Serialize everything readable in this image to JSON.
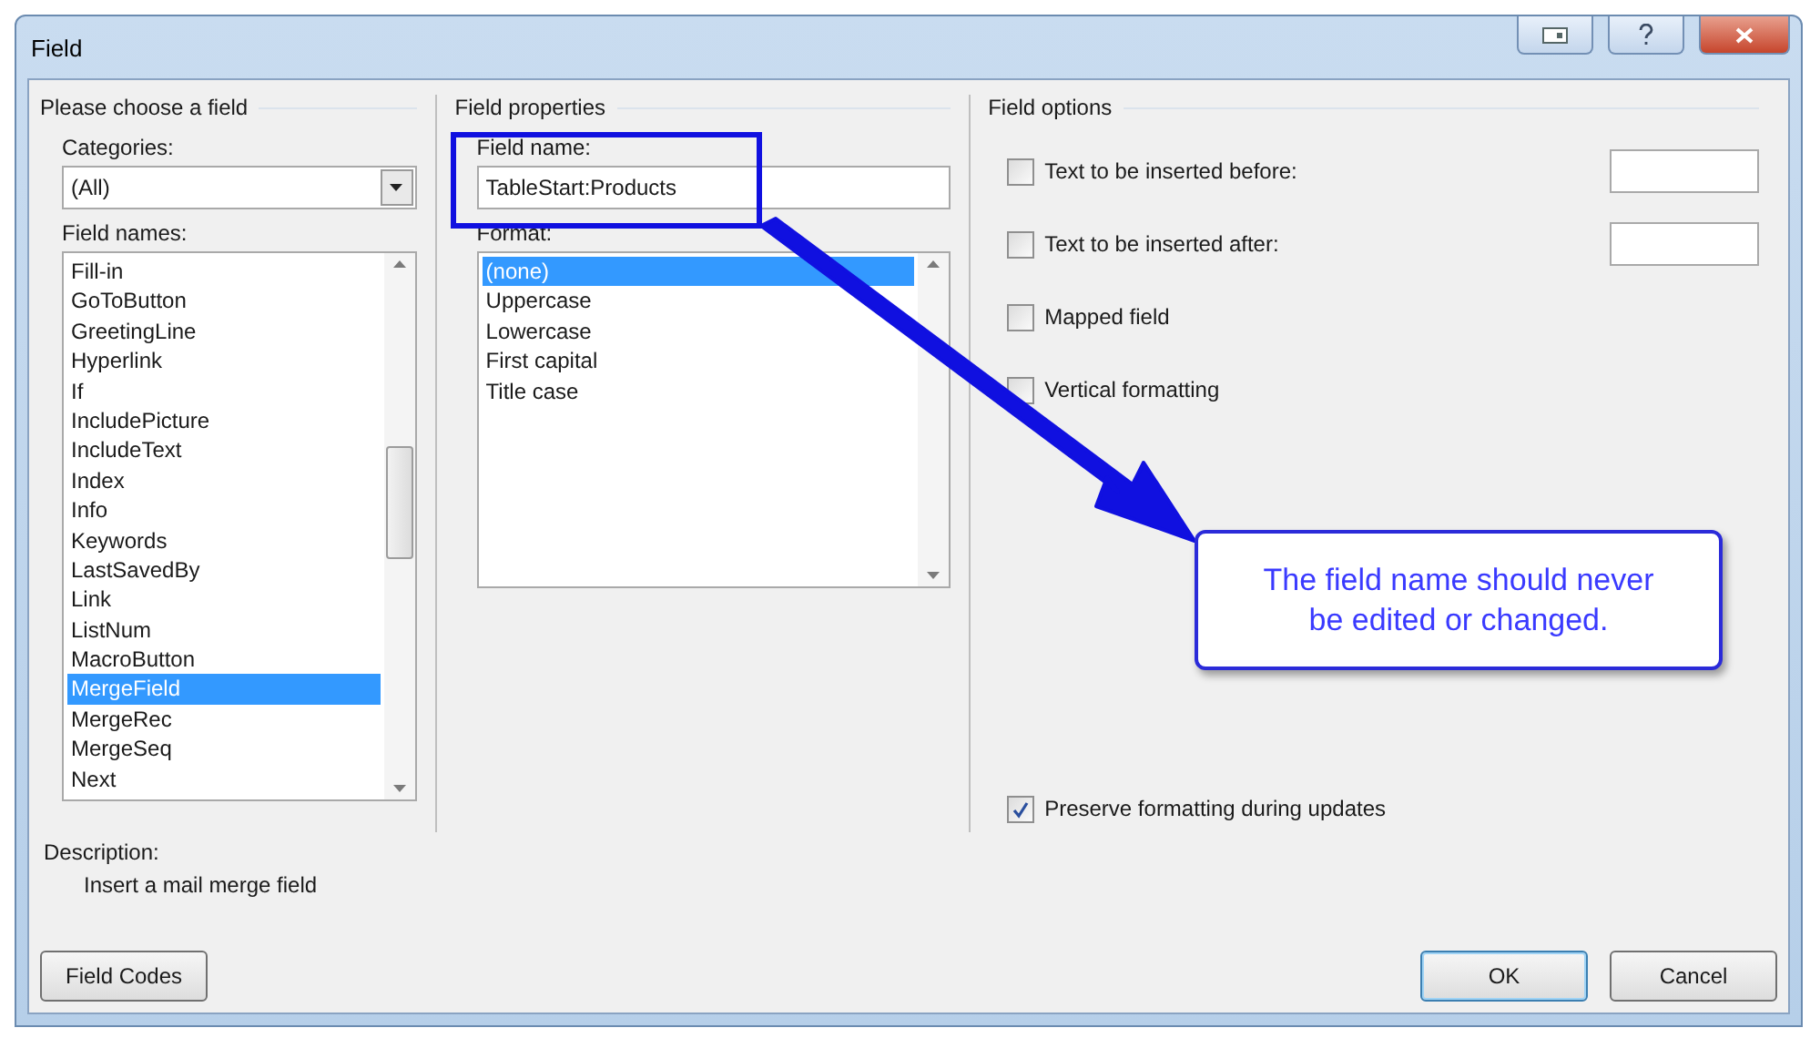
{
  "window": {
    "title": "Field"
  },
  "choose": {
    "heading": "Please choose a field",
    "categories_label": "Categories:",
    "categories_value": "(All)",
    "field_names_label": "Field names:",
    "field_names": [
      {
        "label": "Fill-in",
        "selected": false
      },
      {
        "label": "GoToButton",
        "selected": false
      },
      {
        "label": "GreetingLine",
        "selected": false
      },
      {
        "label": "Hyperlink",
        "selected": false
      },
      {
        "label": "If",
        "selected": false
      },
      {
        "label": "IncludePicture",
        "selected": false
      },
      {
        "label": "IncludeText",
        "selected": false
      },
      {
        "label": "Index",
        "selected": false
      },
      {
        "label": "Info",
        "selected": false
      },
      {
        "label": "Keywords",
        "selected": false
      },
      {
        "label": "LastSavedBy",
        "selected": false
      },
      {
        "label": "Link",
        "selected": false
      },
      {
        "label": "ListNum",
        "selected": false
      },
      {
        "label": "MacroButton",
        "selected": false
      },
      {
        "label": "MergeField",
        "selected": true
      },
      {
        "label": "MergeRec",
        "selected": false
      },
      {
        "label": "MergeSeq",
        "selected": false
      },
      {
        "label": "Next",
        "selected": false
      }
    ]
  },
  "properties": {
    "heading": "Field properties",
    "field_name_label": "Field name:",
    "field_name_value": "TableStart:Products",
    "format_label": "Format:",
    "formats": [
      {
        "label": "(none)",
        "selected": true
      },
      {
        "label": "Uppercase",
        "selected": false
      },
      {
        "label": "Lowercase",
        "selected": false
      },
      {
        "label": "First capital",
        "selected": false
      },
      {
        "label": "Title case",
        "selected": false
      }
    ]
  },
  "options": {
    "heading": "Field options",
    "items": [
      {
        "label": "Text to be inserted before:",
        "checked": false,
        "kind": "input"
      },
      {
        "label": "Text to be inserted after:",
        "checked": false,
        "kind": "input"
      },
      {
        "label": "Mapped field",
        "checked": false,
        "kind": "plain"
      },
      {
        "label": "Vertical formatting",
        "checked": false,
        "kind": "plain"
      }
    ],
    "preserve": {
      "label": "Preserve formatting during updates",
      "checked": true
    }
  },
  "description": {
    "label": "Description:",
    "text": "Insert a mail merge field"
  },
  "buttons": {
    "field_codes": "Field Codes",
    "ok": "OK",
    "cancel": "Cancel"
  },
  "annotation": {
    "text": "The field name should never be edited or changed."
  }
}
